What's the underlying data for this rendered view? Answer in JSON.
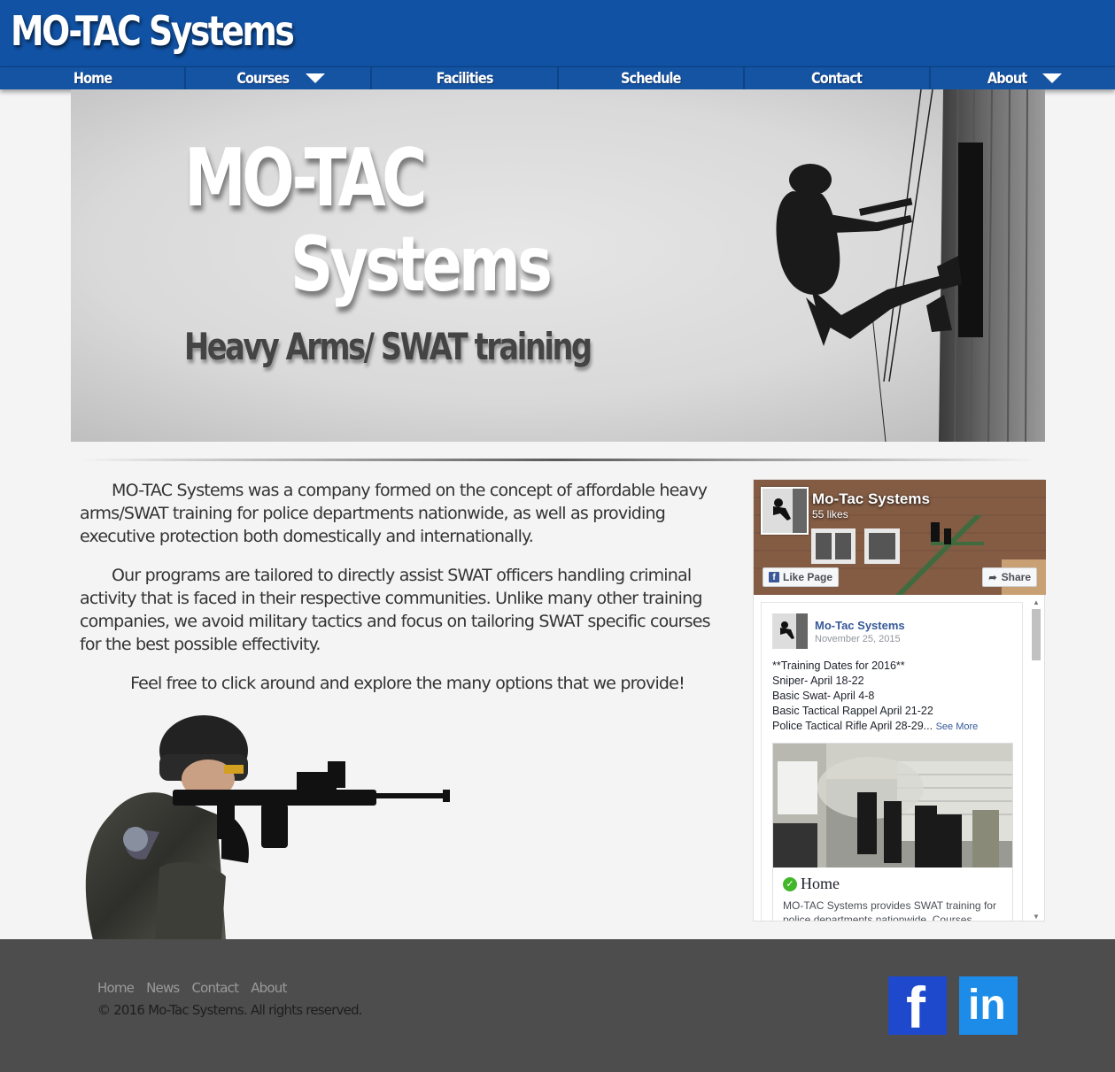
{
  "header": {
    "logo": "MO-TAC Systems"
  },
  "nav": {
    "items": [
      {
        "label": "Home",
        "dropdown": false
      },
      {
        "label": "Courses",
        "dropdown": true
      },
      {
        "label": "Facilities",
        "dropdown": false
      },
      {
        "label": "Schedule",
        "dropdown": false
      },
      {
        "label": "Contact",
        "dropdown": false
      },
      {
        "label": "About",
        "dropdown": true
      }
    ]
  },
  "hero": {
    "title_line1": "MO-TAC",
    "title_line2": "Systems",
    "subtitle": "Heavy Arms/ SWAT training"
  },
  "intro": {
    "paragraph1": "MO-TAC Systems was a company formed on the concept of affordable heavy arms/SWAT training for police departments nationwide, as well as providing executive protection both domestically and internationally.",
    "paragraph2": "Our programs are tailored to directly assist SWAT officers handling criminal activity that is faced in their respective communities. Unlike many other training companies, we avoid military tactics and focus on tailoring SWAT specific courses for the best possible effectivity.",
    "paragraph3": "Feel free to click around and explore the many options that we provide!"
  },
  "facebook": {
    "page_name": "Mo-Tac Systems",
    "likes": "55 likes",
    "like_button": "Like Page",
    "share_button": "Share",
    "post": {
      "author": "Mo-Tac Systems",
      "date": "November 25, 2015",
      "lines": [
        "**Training Dates for 2016**",
        "Sniper- April 18-22",
        "Basic Swat- April 4-8",
        "Basic Tactical Rappel April 21-22",
        "Police Tactical Rifle April 28-29..."
      ],
      "see_more": "See More",
      "attachment_title": "Home",
      "attachment_desc": "MO-TAC Systems provides SWAT training for police departments nationwide. Courses"
    }
  },
  "footer": {
    "links": [
      "Home",
      "News",
      "Contact",
      "About"
    ],
    "copyright": "© 2016 Mo-Tac Systems. All rights reserved."
  },
  "social": {
    "facebook": "f",
    "linkedin": "in"
  },
  "colors": {
    "header_blue": "#1152a4",
    "footer_gray": "#4d4d4d",
    "facebook_blue": "#1e49cc",
    "linkedin_blue": "#1c8ce8"
  }
}
